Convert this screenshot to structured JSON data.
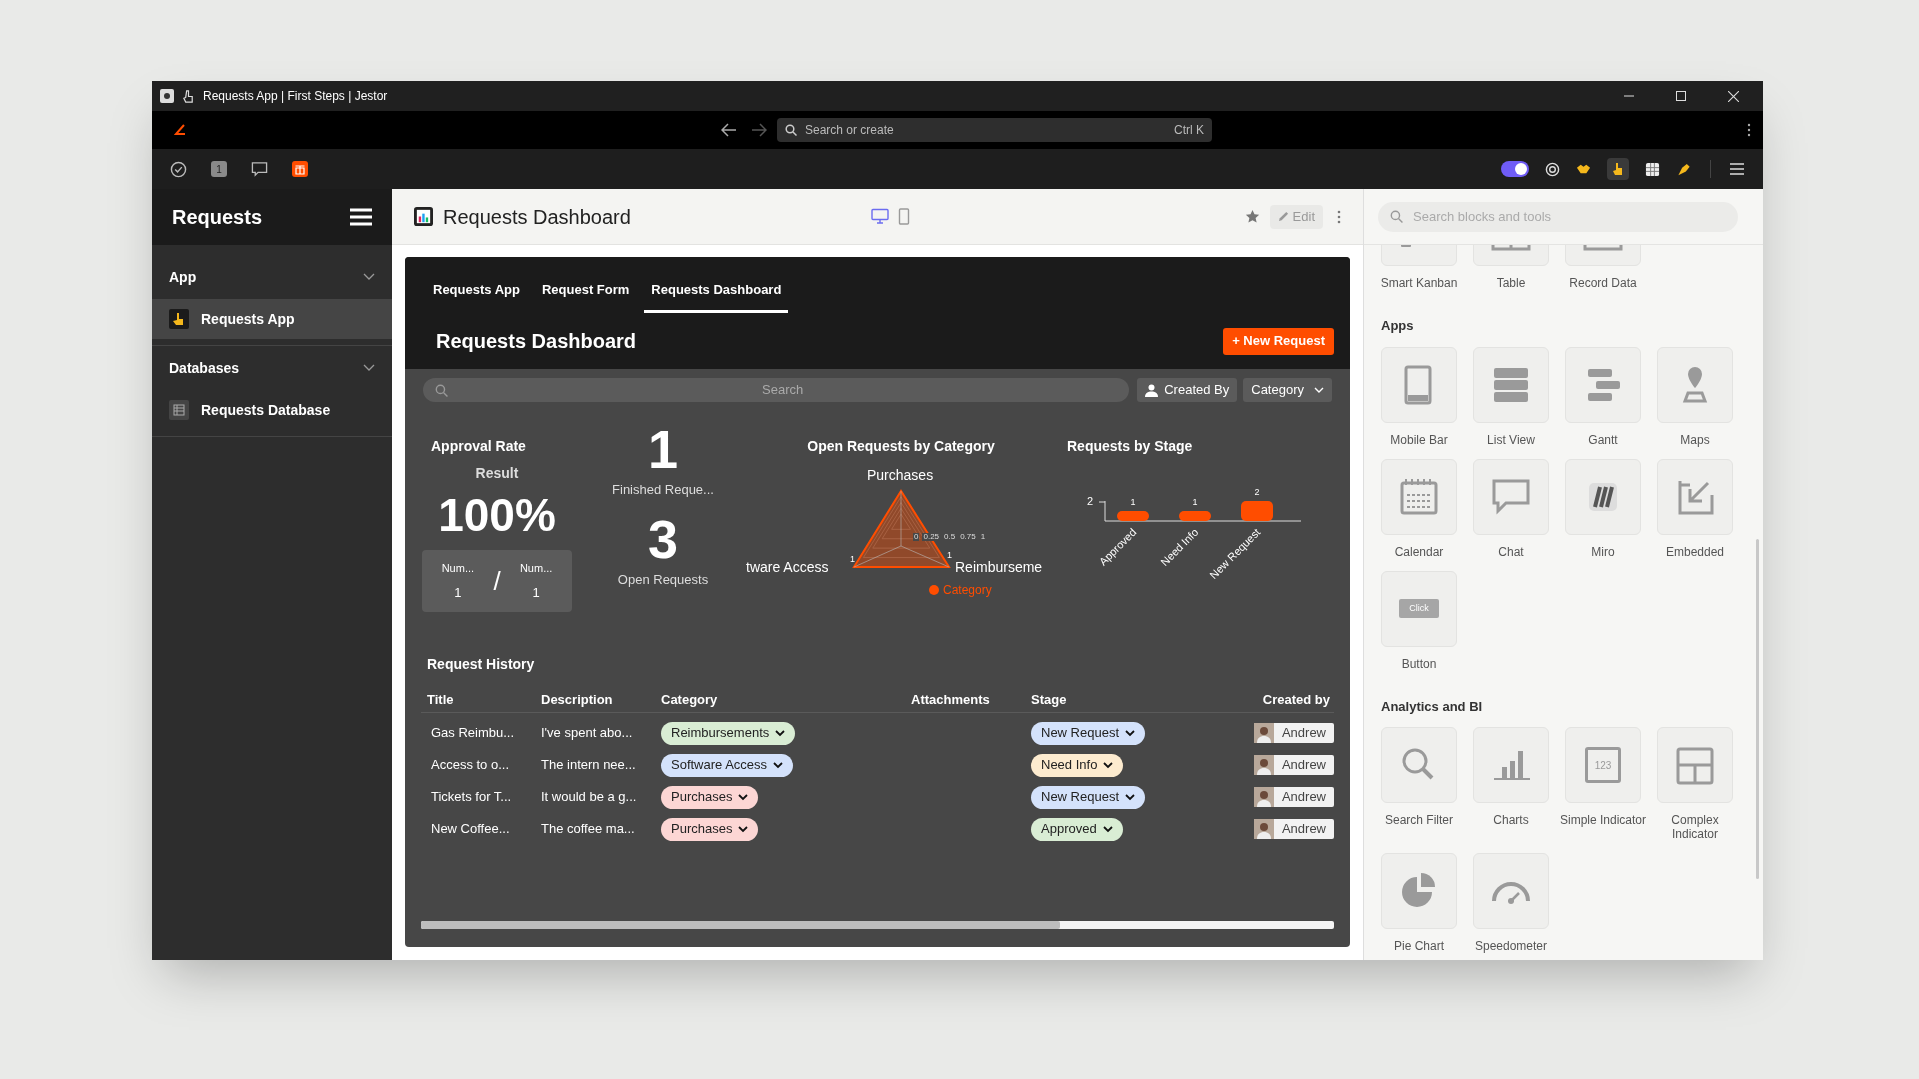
{
  "window": {
    "title": "Requests App | First Steps | Jestor"
  },
  "address_bar": {
    "search": {
      "placeholder": "Search or create",
      "shortcut": "Ctrl K"
    }
  },
  "toolbar": {
    "badge": "1",
    "toggle_on": true
  },
  "sidebar": {
    "title": "Requests",
    "sections": [
      {
        "label": "App",
        "expanded": true,
        "items": [
          {
            "label": "Requests App",
            "kind": "app",
            "selected": true
          }
        ]
      },
      {
        "label": "Databases",
        "expanded": true,
        "items": [
          {
            "label": "Requests Database",
            "kind": "database",
            "selected": false
          }
        ]
      }
    ]
  },
  "page": {
    "title": "Requests Dashboard",
    "views": [
      {
        "kind": "desktop",
        "selected": true
      },
      {
        "kind": "mobile",
        "selected": false
      }
    ],
    "edit_button": "Edit"
  },
  "dashboard": {
    "tabs": [
      {
        "label": "Requests App",
        "selected": false
      },
      {
        "label": "Request Form",
        "selected": false
      },
      {
        "label": "Requests Dashboard",
        "selected": true
      }
    ],
    "title": "Requests Dashboard",
    "new_button": "+ New Request",
    "search": {
      "placeholder": "Search"
    },
    "filters": [
      {
        "label": "Created By",
        "kind": "user"
      },
      {
        "label": "Category",
        "kind": "dropdown"
      }
    ],
    "approval": {
      "title": "Approval Rate",
      "subtitle": "Result",
      "value": "100%",
      "left": {
        "label": "Num...",
        "value": "1"
      },
      "separator": "/",
      "right": {
        "label": "Num...",
        "value": "1"
      }
    },
    "indicators": [
      {
        "value": "1",
        "label": "Finished Reque..."
      },
      {
        "value": "3",
        "label": "Open Requests"
      }
    ],
    "radar": {
      "title": "Open Requests by Category",
      "axes": [
        "Purchases",
        "tware Access",
        "Reimburseme"
      ],
      "value_labels": [
        "1",
        "1"
      ],
      "ticks": [
        "0",
        "0.25",
        "0.5",
        "0.75",
        "1"
      ],
      "legend": {
        "label": "Category",
        "color": "#ff4d00"
      }
    },
    "stage_chart": {
      "title": "Requests by Stage",
      "axis_label": "2",
      "chart_data": {
        "type": "bar",
        "categories": [
          "Approved",
          "Need Info",
          "New Request"
        ],
        "series": [
          {
            "color": "#ff4d00",
            "values": [
              1,
              1,
              2
            ]
          }
        ],
        "data_labels": true
      }
    },
    "history": {
      "title": "Request History",
      "columns": [
        "Title",
        "Description",
        "Category",
        "Attachments",
        "Stage",
        "Created by"
      ],
      "rows": [
        {
          "title": "Gas Reimbu...",
          "description": "I've spent abo...",
          "category": {
            "label": "Reimbursements",
            "color": "#d9edd4"
          },
          "stage": {
            "label": "New Request",
            "color": "#d4e2fb"
          },
          "created_by": "Andrew"
        },
        {
          "title": "Access to o...",
          "description": "The intern nee...",
          "category": {
            "label": "Software Access",
            "color": "#d4e2fb"
          },
          "stage": {
            "label": "Need Info",
            "color": "#fdebcf"
          },
          "created_by": "Andrew"
        },
        {
          "title": "Tickets for T...",
          "description": "It would be a g...",
          "category": {
            "label": "Purchases",
            "color": "#fcd6d4"
          },
          "stage": {
            "label": "New Request",
            "color": "#d4e2fb"
          },
          "created_by": "Andrew"
        },
        {
          "title": "New Coffee...",
          "description": "The coffee ma...",
          "category": {
            "label": "Purchases",
            "color": "#fcd6d4"
          },
          "stage": {
            "label": "Approved",
            "color": "#d9edd4"
          },
          "created_by": "Andrew"
        }
      ]
    }
  },
  "blocks_panel": {
    "search": {
      "placeholder": "Search blocks and tools"
    },
    "partial_items": [
      {
        "label": "Smart Kanban",
        "kind": "kanban"
      },
      {
        "label": "Table",
        "kind": "table"
      },
      {
        "label": "Record Data",
        "kind": "record"
      }
    ],
    "sections": [
      {
        "title": "Apps",
        "items": [
          {
            "label": "Mobile Bar",
            "kind": "mobile"
          },
          {
            "label": "List View",
            "kind": "list"
          },
          {
            "label": "Gantt",
            "kind": "gantt"
          },
          {
            "label": "Maps",
            "kind": "map"
          },
          {
            "label": "Calendar",
            "kind": "calendar"
          },
          {
            "label": "Chat",
            "kind": "chat"
          },
          {
            "label": "Miro",
            "kind": "miro"
          },
          {
            "label": "Embedded",
            "kind": "embed"
          },
          {
            "label": "Button",
            "kind": "button",
            "button_text": "Click"
          }
        ]
      },
      {
        "title": "Analytics and BI",
        "items": [
          {
            "label": "Search Filter",
            "kind": "search"
          },
          {
            "label": "Charts",
            "kind": "charts"
          },
          {
            "label": "Simple Indicator",
            "kind": "indicator",
            "icon_text": "123"
          },
          {
            "label": "Complex Indicator",
            "kind": "complex"
          },
          {
            "label": "Pie Chart",
            "kind": "pie"
          },
          {
            "label": "Speedometer",
            "kind": "gauge"
          }
        ]
      }
    ]
  }
}
